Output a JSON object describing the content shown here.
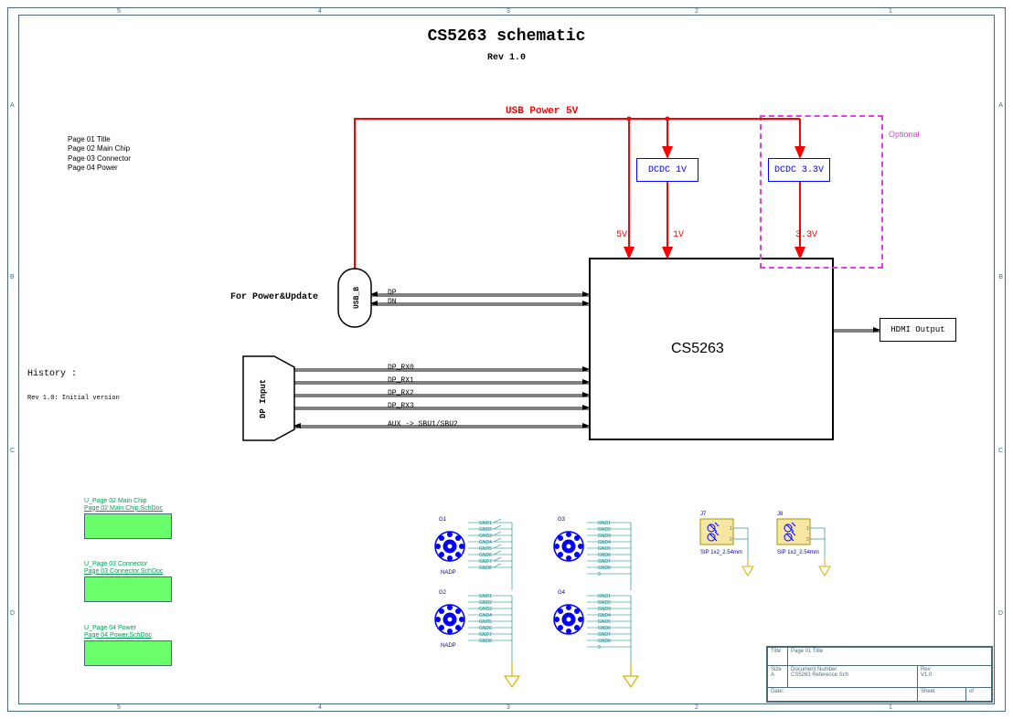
{
  "title": "CS5263  schematic",
  "subtitle": "Rev 1.0",
  "pages": [
    "Page 01 Title",
    "Page 02 Main Chip",
    "Page 03 Connector",
    "Page 04 Power"
  ],
  "history": "History :",
  "history_note": "Rev 1.0: Initial version",
  "usb_power": "USB Power 5V",
  "for_power_update": "For Power&Update",
  "main_chip": "CS5263",
  "hdmi_output": "HDMI Output",
  "dcdc1": "DCDC 1V",
  "dcdc2": "DCDC 3.3V",
  "voltages": {
    "v5": "5V",
    "v1": "1V",
    "v33": "3.3V"
  },
  "optional": "Optional",
  "usb_b_label": "USB_B",
  "dp_input_label": "DP Input",
  "signals": {
    "dp": "DP",
    "dn": "DN",
    "rx0": "DP_RX0",
    "rx1": "DP_RX1",
    "rx2": "DP_RX2",
    "rx3": "DP_RX3",
    "aux": "AUX -> SBU1/SBU2"
  },
  "hier_blocks": [
    {
      "top1": "U_Page 02 Main Chip",
      "top2": "Page 02 Main Chip.SchDoc"
    },
    {
      "top1": "U_Page 03 Connector",
      "top2": "Page 03 Connector.SchDoc"
    },
    {
      "top1": "U_Page 04 Power",
      "top2": "Page 04 Power.SchDoc"
    }
  ],
  "ground_comp": {
    "ref_g1": "G1",
    "ref_g2": "G2",
    "ref_g3": "G3",
    "ref_g4": "G4",
    "ref_nadp": "NADP",
    "gnd_nets": [
      "GND1",
      "GND2",
      "GND3",
      "GND4",
      "GND5",
      "GND6",
      "GND7",
      "GND8"
    ]
  },
  "jumpers": {
    "j7": {
      "ref": "J7",
      "desig": "SIP 1x2_2.54mm"
    },
    "j8": {
      "ref": "J8",
      "desig": "SIP 1x2_2.54mm"
    }
  },
  "titleblock": {
    "title_label": "Title",
    "title_value": "Page 01 Title",
    "size_label": "Size",
    "size_value": "A",
    "docnum_label": "Document Number",
    "docnum_value": "CS5263 Reference Sch",
    "rev_label": "Rev",
    "rev_value": "V1.0",
    "date_label": "Date:",
    "sheet_label": "Sheet",
    "of_label": "of"
  },
  "zone_letters": [
    "A",
    "B",
    "C",
    "D"
  ],
  "zone_numbers": [
    "1",
    "2",
    "3",
    "4",
    "5"
  ]
}
